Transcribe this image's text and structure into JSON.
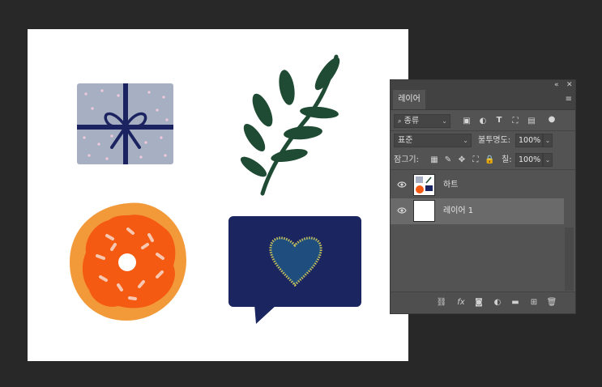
{
  "panel": {
    "collapse_icon": "«",
    "close_icon": "✕",
    "tab_label": "레이어",
    "menu_icon": "≡",
    "filter": {
      "search_icon": "🔍",
      "kind_label": "종류",
      "icons": [
        "image-filter-icon",
        "adjustment-filter-icon",
        "type-filter-icon",
        "shape-filter-icon",
        "smart-object-filter-icon",
        "filter-toggle-icon"
      ]
    },
    "blend_mode": "표준",
    "opacity_label": "불투명도:",
    "opacity_value": "100%",
    "lock_label": "잠그기:",
    "fill_label": "칠:",
    "fill_value": "100%",
    "layers": [
      {
        "name": "하트",
        "selected": false
      },
      {
        "name": "레이어 1",
        "selected": true
      }
    ],
    "footer_icons": [
      "link-layers-icon",
      "fx-icon",
      "add-mask-icon",
      "adjustment-layer-icon",
      "group-folder-icon",
      "new-layer-icon",
      "trash-icon"
    ]
  },
  "colors": {
    "workspace": "#282828",
    "panel": "#535353",
    "selected_layer": "#6a6a6a"
  }
}
